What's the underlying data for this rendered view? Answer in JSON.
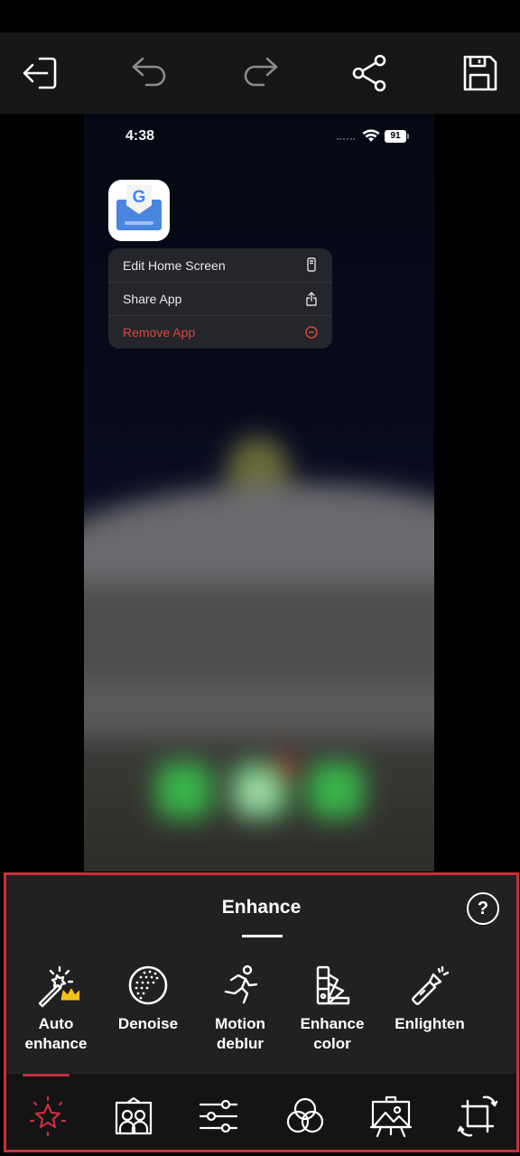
{
  "toolbar": {
    "buttons": [
      {
        "name": "exit",
        "icon": "exit-icon"
      },
      {
        "name": "undo",
        "icon": "undo-icon"
      },
      {
        "name": "redo",
        "icon": "redo-icon"
      },
      {
        "name": "share",
        "icon": "share-icon"
      },
      {
        "name": "save",
        "icon": "save-icon"
      }
    ]
  },
  "phone": {
    "status": {
      "time": "4:38",
      "battery": "91"
    },
    "app_icon": {
      "letter": "G",
      "icon": "gboard-icon"
    },
    "context_menu": [
      {
        "label": "Edit Home Screen",
        "icon": "phone-icon"
      },
      {
        "label": "Share App",
        "icon": "share-up-icon"
      },
      {
        "label": "Remove App",
        "icon": "minus-circle-icon",
        "destructive": true
      }
    ]
  },
  "panel": {
    "title": "Enhance",
    "help_label": "?",
    "tools": [
      {
        "label_line1": "Auto",
        "label_line2": "enhance",
        "icon": "magic-wand-icon",
        "premium": true
      },
      {
        "label_line1": "Denoise",
        "label_line2": "",
        "icon": "denoise-icon"
      },
      {
        "label_line1": "Motion",
        "label_line2": "deblur",
        "icon": "running-person-icon"
      },
      {
        "label_line1": "Enhance",
        "label_line2": "color",
        "icon": "color-swatch-icon"
      },
      {
        "label_line1": "Enlighten",
        "label_line2": "",
        "icon": "flashlight-icon"
      }
    ],
    "tabs": [
      {
        "name": "enhance",
        "icon": "sparkle-star-icon",
        "active": true
      },
      {
        "name": "portrait",
        "icon": "portrait-frame-icon"
      },
      {
        "name": "adjust",
        "icon": "sliders-icon"
      },
      {
        "name": "filters",
        "icon": "color-circles-icon"
      },
      {
        "name": "art",
        "icon": "easel-icon"
      },
      {
        "name": "crop",
        "icon": "crop-rotate-icon"
      }
    ]
  },
  "colors": {
    "accent": "#c8303b",
    "premium": "#f2c21b",
    "destructive": "#d8473f"
  }
}
